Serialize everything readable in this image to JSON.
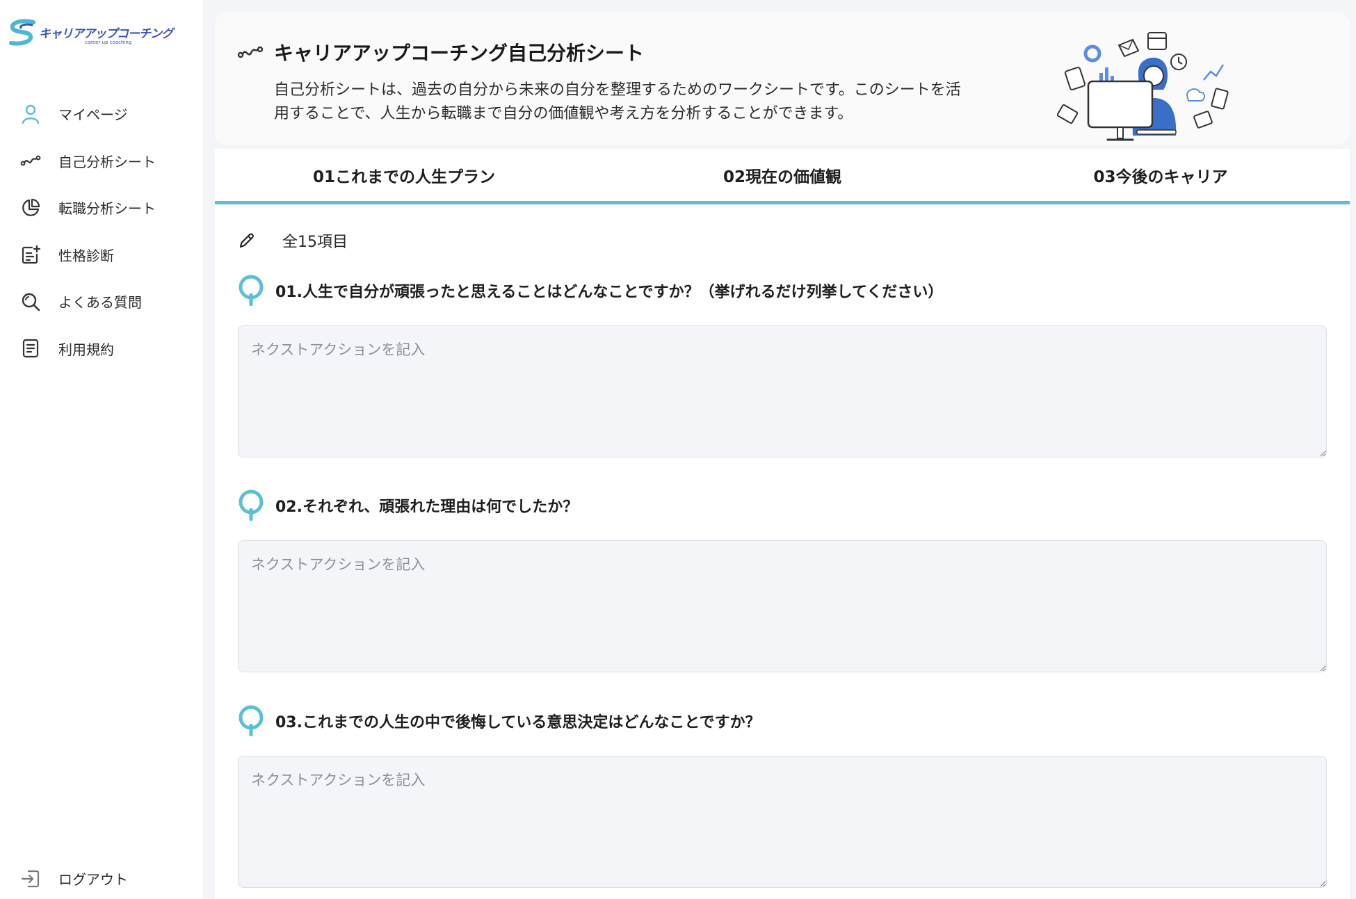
{
  "brand": {
    "logo_text": "キャリアアップコーチング",
    "logo_sub": "career up coaching"
  },
  "sidebar": {
    "items": [
      {
        "label": "マイページ",
        "icon": "user-icon"
      },
      {
        "label": "自己分析シート",
        "icon": "wave-icon"
      },
      {
        "label": "転職分析シート",
        "icon": "pie-chart-icon"
      },
      {
        "label": "性格診断",
        "icon": "clipboard-plus-icon"
      },
      {
        "label": "よくある質問",
        "icon": "search-icon"
      },
      {
        "label": "利用規約",
        "icon": "document-icon"
      }
    ],
    "logout": {
      "label": "ログアウト",
      "icon": "logout-icon"
    }
  },
  "header": {
    "title": "キャリアアップコーチング自己分析シート",
    "description": "自己分析シートは、過去の自分から未来の自分を整理するためのワークシートです。このシートを活用することで、人生から転職まで自分の価値観や考え方を分析することができます。"
  },
  "tabs": [
    {
      "label": "01これまでの人生プラン"
    },
    {
      "label": "02現在の価値観"
    },
    {
      "label": "03今後のキャリア"
    }
  ],
  "accent_color": "#5bbfd6",
  "item_count": "全15項目",
  "questions": [
    {
      "text": "01.人生で自分が頑張ったと思えることはどんなことですか？（挙げれるだけ列挙してください）",
      "placeholder": "ネクストアクションを記入",
      "value": ""
    },
    {
      "text": "02.それぞれ、頑張れた理由は何でしたか？",
      "placeholder": "ネクストアクションを記入",
      "value": ""
    },
    {
      "text": "03.これまでの人生の中で後悔している意思決定はどんなことですか？",
      "placeholder": "ネクストアクションを記入",
      "value": ""
    }
  ]
}
